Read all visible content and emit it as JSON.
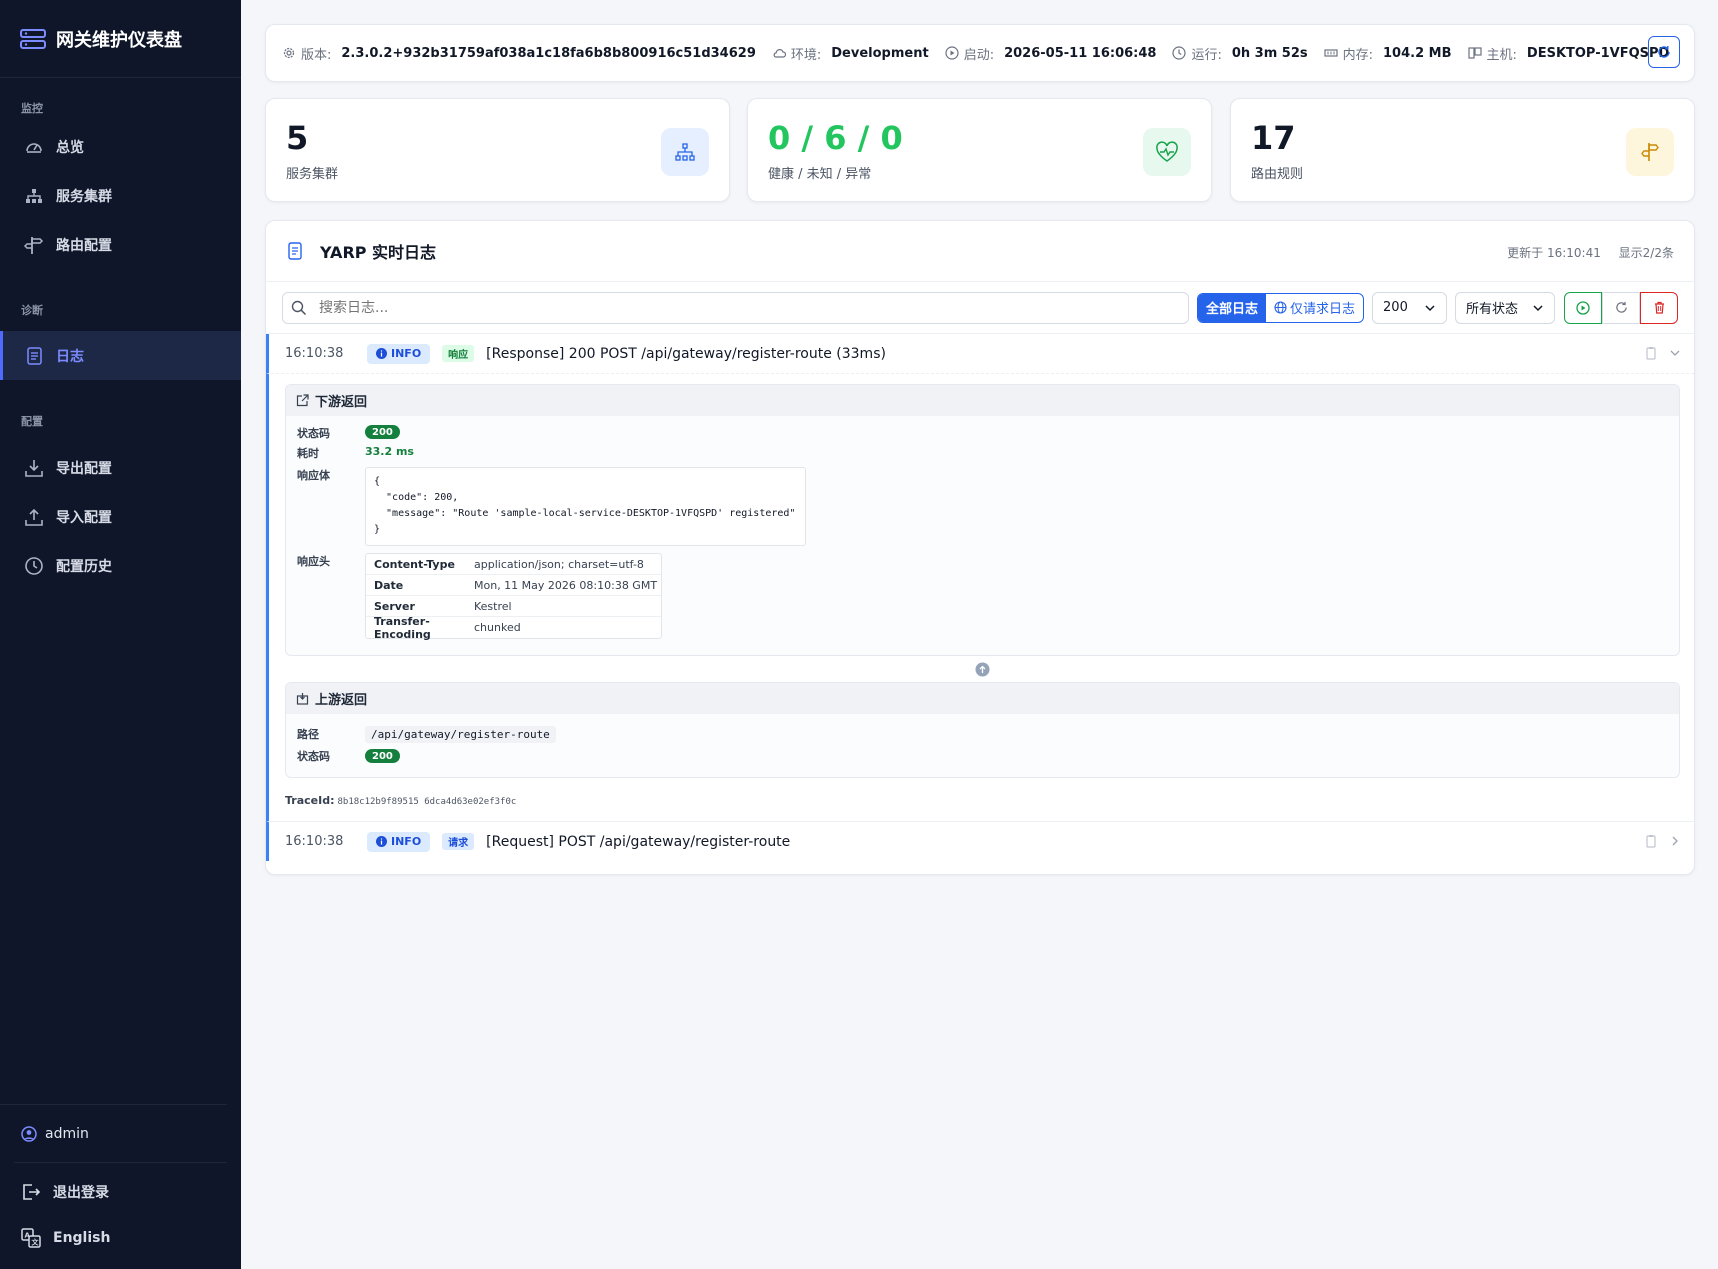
{
  "app": {
    "title": "网关维护仪表盘"
  },
  "nav": {
    "sections": {
      "monitor": "监控",
      "diagnose": "诊断",
      "config": "配置"
    },
    "items": {
      "overview": "总览",
      "clusters": "服务集群",
      "routes": "路由配置",
      "logs": "日志",
      "export": "导出配置",
      "import": "导入配置",
      "history": "配置历史"
    },
    "user": "admin",
    "logout": "退出登录",
    "language": "English"
  },
  "info": {
    "version_label": "版本:",
    "version": "2.3.0.2+932b31759af038a1c18fa6b8b800916c51d34629",
    "env_label": "环境:",
    "env": "Development",
    "start_label": "启动:",
    "start": "2026-05-11 16:06:48",
    "uptime_label": "运行:",
    "uptime": "0h 3m 52s",
    "memory_label": "内存:",
    "memory": "104.2 MB",
    "host_label": "主机:",
    "host": "DESKTOP-1VFQSPD"
  },
  "stats": {
    "clusters": {
      "value": "5",
      "label": "服务集群"
    },
    "health": {
      "value": "0 / 6 / 0",
      "label": "健康 / 未知 / 异常"
    },
    "routes": {
      "value": "17",
      "label": "路由规则"
    }
  },
  "log": {
    "title": "YARP 实时日志",
    "updated": "更新于 16:10:41",
    "shown": "显示2/2条",
    "search_placeholder": "搜索日志...",
    "filter_all": "全部日志",
    "filter_request": "仅请求日志",
    "limit": "200",
    "status_filter": "所有状态",
    "entries": [
      {
        "time": "16:10:38",
        "level": "INFO",
        "type": "响应",
        "message": "[Response] 200 POST /api/gateway/register-route (33ms)"
      },
      {
        "time": "16:10:38",
        "level": "INFO",
        "type": "请求",
        "message": "[Request] POST /api/gateway/register-route"
      }
    ],
    "downstream": {
      "title": "下游返回",
      "status_label": "状态码",
      "status": "200",
      "duration_label": "耗时",
      "duration": "33.2 ms",
      "body_label": "响应体",
      "body": "{\n  \"code\": 200,\n  \"message\": \"Route 'sample-local-service-DESKTOP-1VFQSPD' registered\"\n}",
      "headers_label": "响应头",
      "headers": [
        {
          "k": "Content-Type",
          "v": "application/json; charset=utf-8"
        },
        {
          "k": "Date",
          "v": "Mon, 11 May 2026 08:10:38 GMT"
        },
        {
          "k": "Server",
          "v": "Kestrel"
        },
        {
          "k": "Transfer-Encoding",
          "v": "chunked"
        }
      ]
    },
    "upstream": {
      "title": "上游返回",
      "path_label": "路径",
      "path": "/api/gateway/register-route",
      "status_label": "状态码",
      "status": "200"
    },
    "trace_label": "TraceId:",
    "trace_id": "8b18c12b9f89515 6dca4d63e02ef3f0c"
  },
  "colors": {
    "sidebar": "#0f1629",
    "accent": "#2563eb",
    "health": "#22c55e",
    "active_nav": "#7c8cff"
  }
}
